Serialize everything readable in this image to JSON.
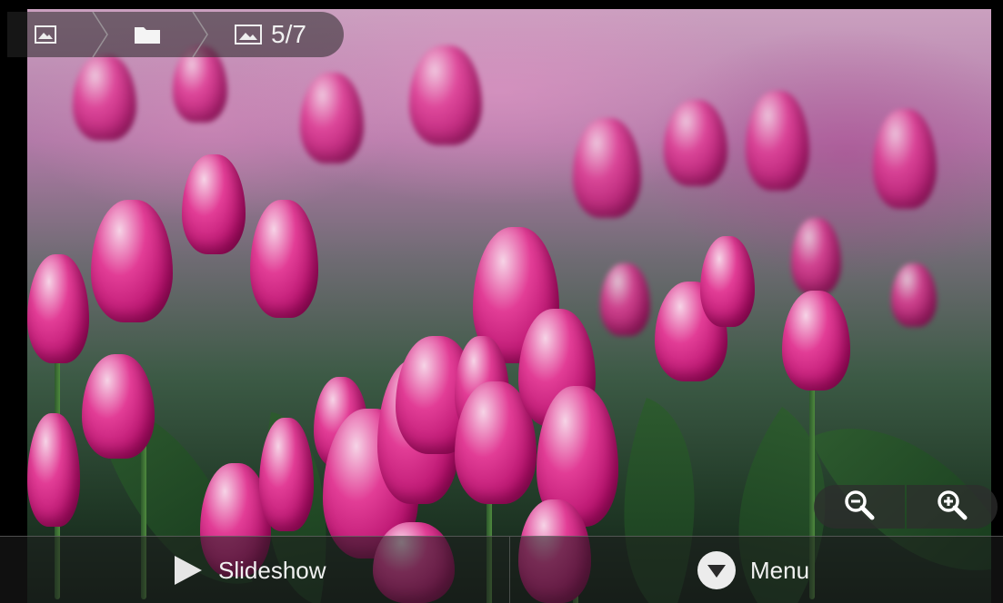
{
  "breadcrumb": {
    "items": [
      {
        "icon": "image-icon"
      },
      {
        "icon": "folder-icon"
      },
      {
        "icon": "image-icon",
        "label": "5/7"
      }
    ]
  },
  "zoom": {
    "out_icon": "zoom-out-icon",
    "in_icon": "zoom-in-icon"
  },
  "bottom_bar": {
    "slideshow_label": "Slideshow",
    "menu_label": "Menu"
  },
  "colors": {
    "bar_bg": "#1e1e1e",
    "text": "#f2f2f2",
    "tulip": "#d62b86"
  }
}
